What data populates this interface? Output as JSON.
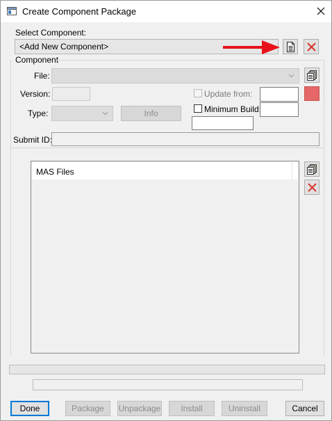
{
  "window": {
    "title": "Create Component Package"
  },
  "select_component": {
    "label": "Select Component:",
    "value": "<Add New Component>"
  },
  "component": {
    "group_label": "Component",
    "file_label": "File:",
    "file_value": "",
    "version_label": "Version:",
    "version_value": "",
    "update_from_label": "Update from:",
    "update_from_checked": false,
    "update_from_value": "",
    "type_label": "Type:",
    "type_value": "",
    "info_label": "Info",
    "minimum_build_label": "Minimum Build:",
    "minimum_build_checked": false,
    "minimum_build_value": "",
    "extra_value": "",
    "submit_id_label": "Submit ID:",
    "submit_id_value": ""
  },
  "files": {
    "column_header": "MAS Files",
    "items": []
  },
  "status": {
    "progress": 0,
    "message": ""
  },
  "footer": {
    "done": "Done",
    "package": "Package",
    "unpackage": "Unpackage",
    "install": "Install",
    "uninstall": "Uninstall",
    "cancel": "Cancel"
  },
  "colors": {
    "annotation_arrow": "#e8111a",
    "delete_red": "#d9352b",
    "color_swatch": "#e66767",
    "default_button_border": "#0078d7"
  },
  "icons": {
    "new_component": "document-icon",
    "delete_component": "red-x-icon",
    "browse_file": "file-browse-icon",
    "add_files": "file-browse-icon",
    "remove_files": "red-x-icon",
    "close": "close-icon"
  }
}
